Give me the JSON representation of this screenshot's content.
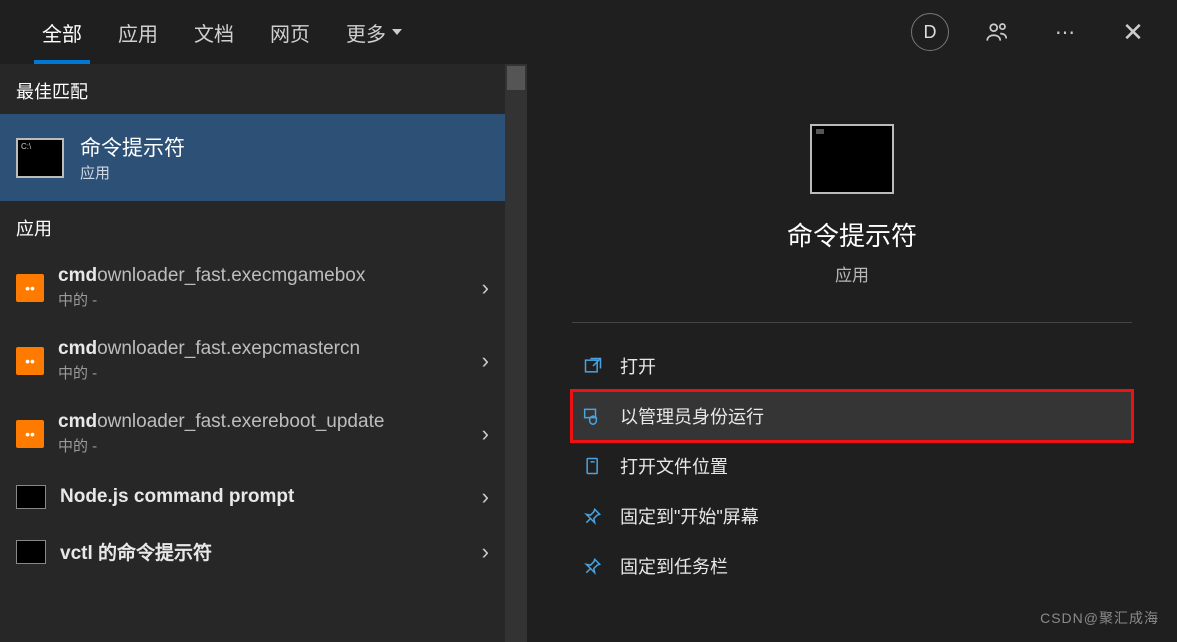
{
  "top": {
    "tabs": [
      "全部",
      "应用",
      "文档",
      "网页",
      "更多"
    ],
    "activeTab": "全部",
    "avatar": "D"
  },
  "left": {
    "bestHeader": "最佳匹配",
    "best": {
      "title": "命令提示符",
      "subtitle": "应用"
    },
    "appsHeader": "应用",
    "items": [
      {
        "bold": "cmd",
        "rest": "ownloader_fast.exe",
        "tail": "cmgamebox 中的 ",
        "icon": "orange"
      },
      {
        "bold": "cmd",
        "rest": "ownloader_fast.exe",
        "tail": "pcmastercn 中的 ",
        "icon": "orange"
      },
      {
        "bold": "cmd",
        "rest": "ownloader_fast.exe",
        "tail": "reboot_update 中的 ",
        "icon": "orange"
      },
      {
        "bold": "Node.js command prompt",
        "rest": "",
        "tail": "",
        "icon": "cmd"
      },
      {
        "bold": "vctl 的命令提示符",
        "rest": "",
        "tail": "",
        "icon": "cmd"
      }
    ]
  },
  "right": {
    "title": "命令提示符",
    "subtitle": "应用",
    "actions": [
      {
        "label": "打开",
        "icon": "open",
        "hl": false
      },
      {
        "label": "以管理员身份运行",
        "icon": "admin",
        "hl": true
      },
      {
        "label": "打开文件位置",
        "icon": "folder",
        "hl": false
      },
      {
        "label": "固定到\"开始\"屏幕",
        "icon": "pin",
        "hl": false
      },
      {
        "label": "固定到任务栏",
        "icon": "pin",
        "hl": false
      }
    ]
  },
  "watermark": "CSDN@聚汇成海"
}
